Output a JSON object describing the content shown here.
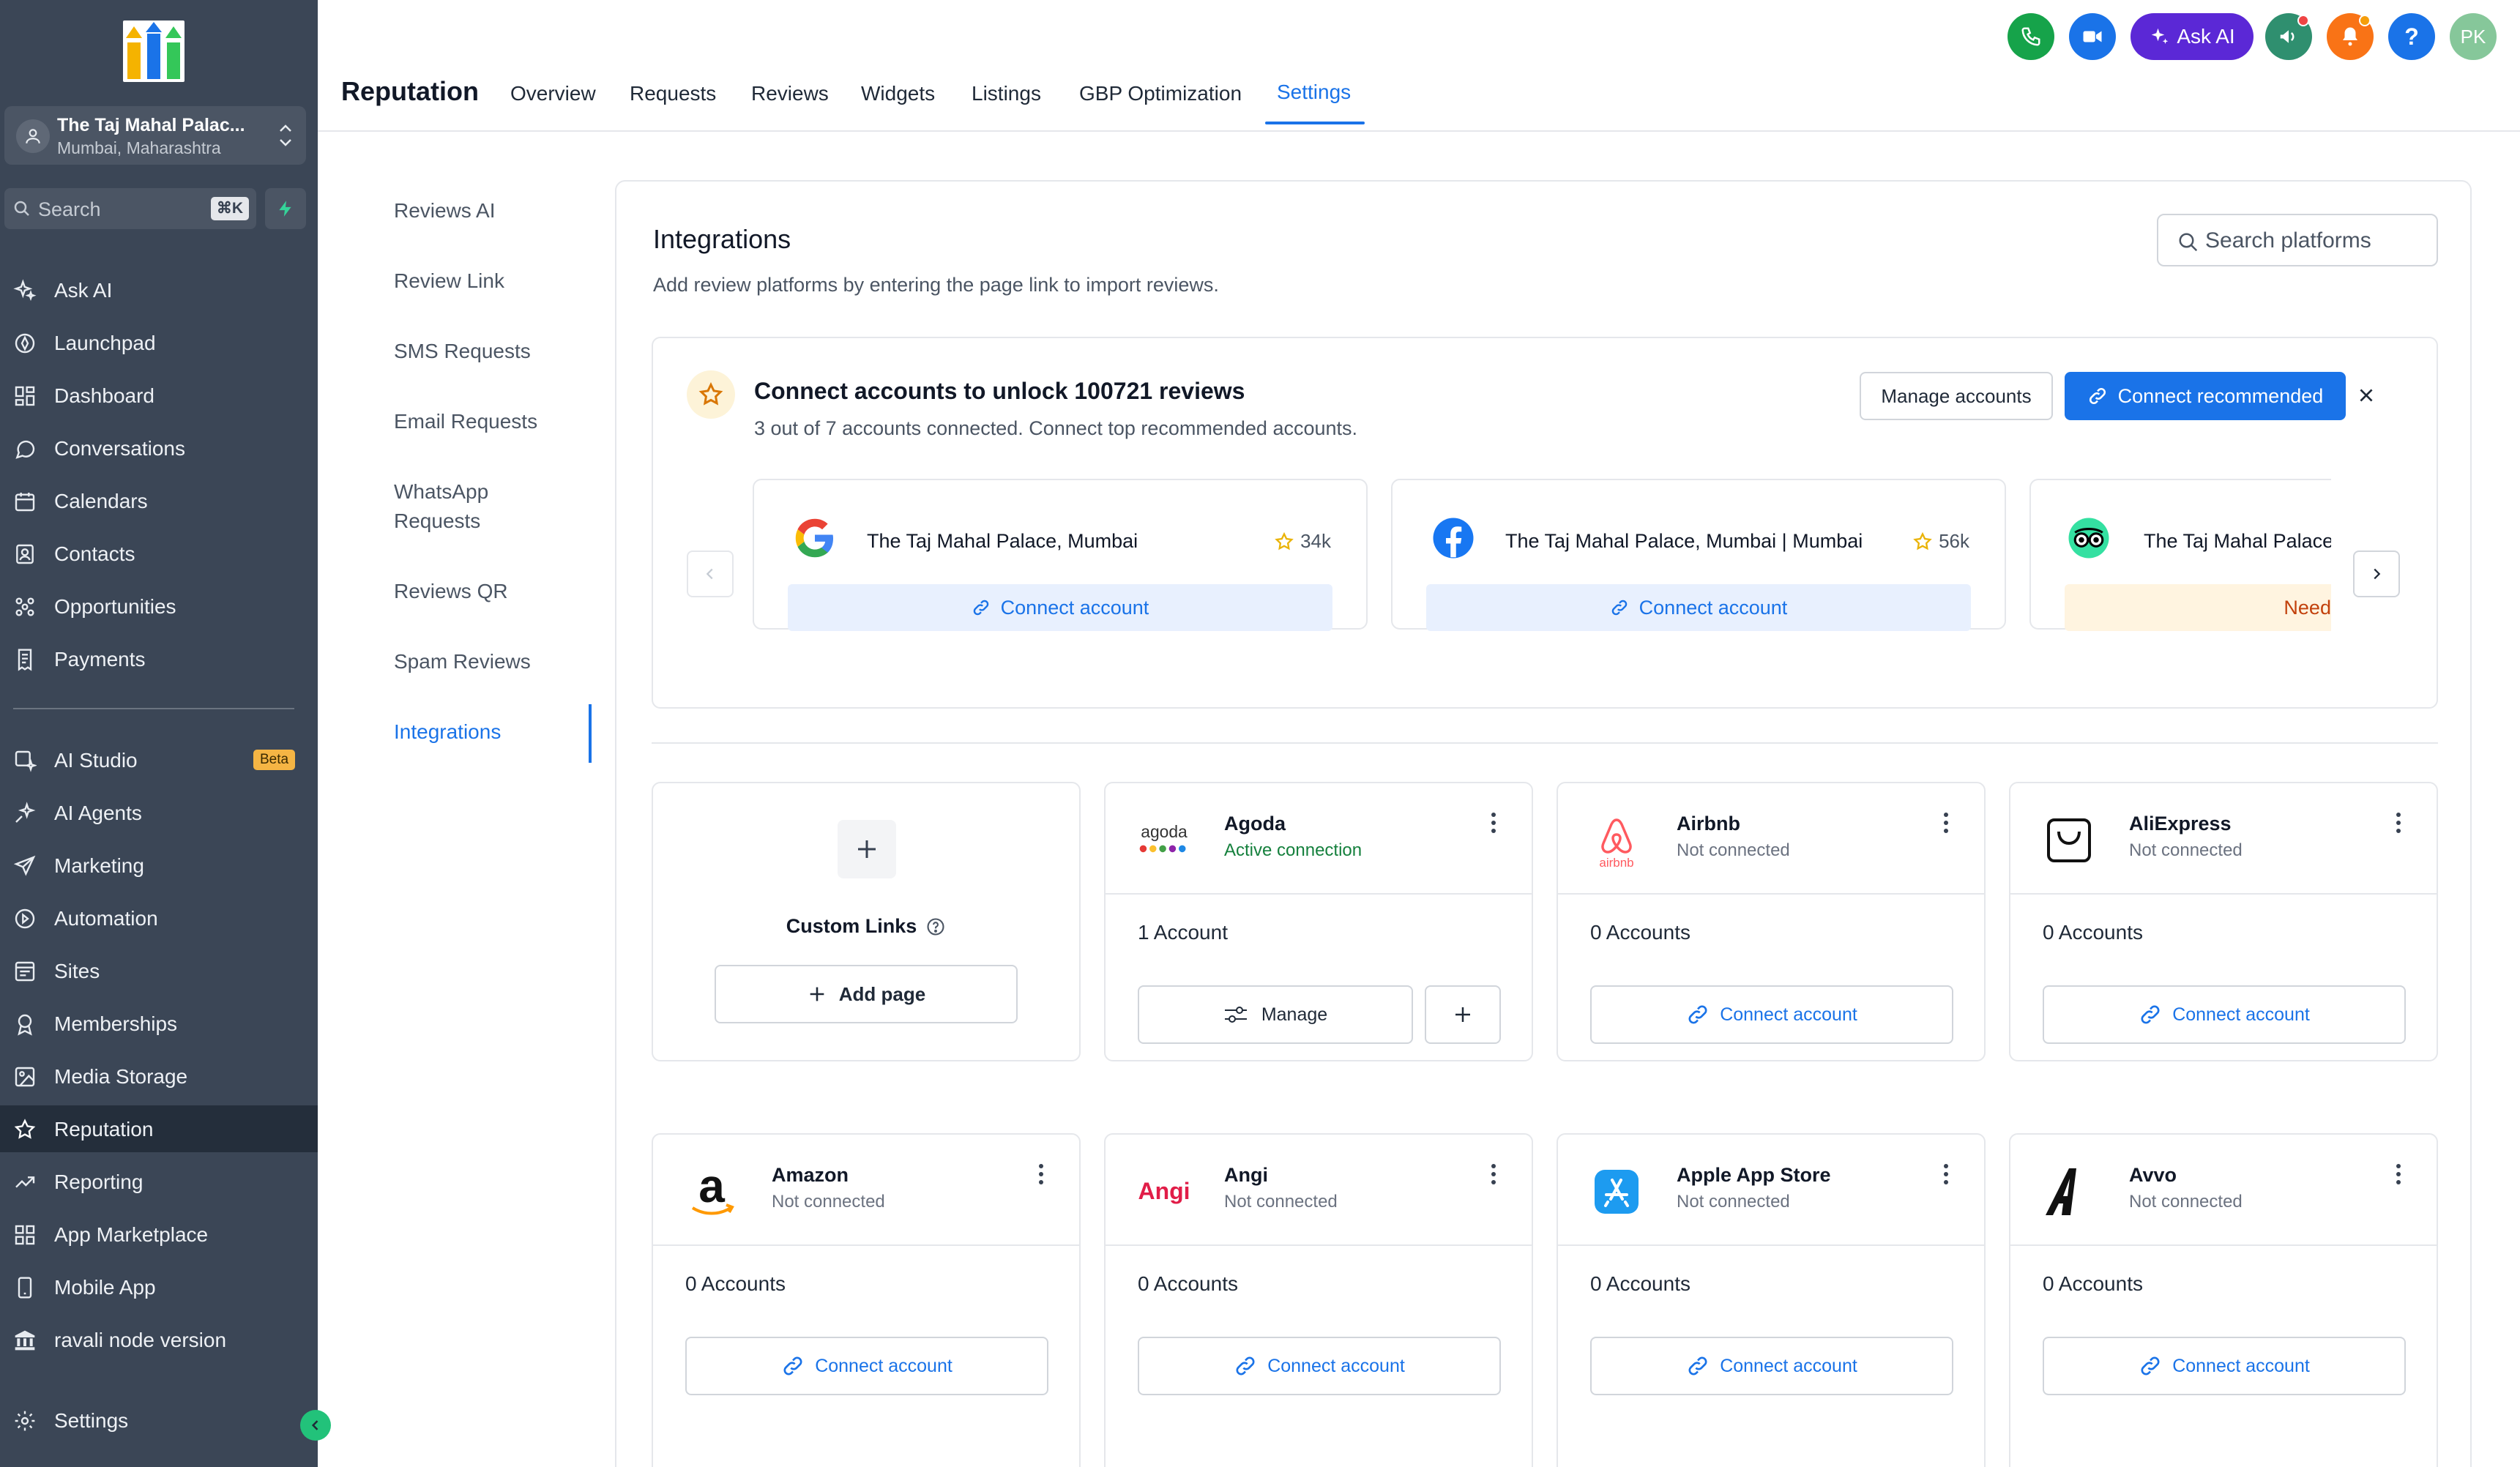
{
  "sidebar": {
    "location": {
      "name": "The Taj Mahal Palac...",
      "city": "Mumbai, Maharashtra"
    },
    "search": {
      "placeholder": "Search",
      "shortcut": "⌘K"
    },
    "items": [
      {
        "label": "Ask AI",
        "icon": "sparkles-icon"
      },
      {
        "label": "Launchpad",
        "icon": "rocket-icon"
      },
      {
        "label": "Dashboard",
        "icon": "grid-icon"
      },
      {
        "label": "Conversations",
        "icon": "chat-icon"
      },
      {
        "label": "Calendars",
        "icon": "calendar-icon"
      },
      {
        "label": "Contacts",
        "icon": "contacts-icon"
      },
      {
        "label": "Opportunities",
        "icon": "funnel-icon"
      },
      {
        "label": "Payments",
        "icon": "receipt-icon"
      }
    ],
    "items2": [
      {
        "label": "AI Studio",
        "icon": "ai-studio-icon",
        "badge": "Beta"
      },
      {
        "label": "AI Agents",
        "icon": "agents-icon"
      },
      {
        "label": "Marketing",
        "icon": "send-icon"
      },
      {
        "label": "Automation",
        "icon": "automation-icon"
      },
      {
        "label": "Sites",
        "icon": "sites-icon"
      },
      {
        "label": "Memberships",
        "icon": "membership-icon"
      },
      {
        "label": "Media Storage",
        "icon": "media-icon"
      },
      {
        "label": "Reputation",
        "icon": "star-icon"
      },
      {
        "label": "Reporting",
        "icon": "trend-icon"
      },
      {
        "label": "App Marketplace",
        "icon": "apps-icon"
      },
      {
        "label": "Mobile App",
        "icon": "mobile-icon"
      },
      {
        "label": "ravali node version",
        "icon": "bank-icon"
      }
    ],
    "settings": "Settings"
  },
  "header": {
    "title": "Reputation",
    "tabs": [
      "Overview",
      "Requests",
      "Reviews",
      "Widgets",
      "Listings",
      "GBP Optimization",
      "Settings"
    ],
    "active_tab": "Settings",
    "ask_ai": "Ask AI",
    "avatar": "PK",
    "help": "?"
  },
  "settings_menu": [
    "Reviews AI",
    "Review Link",
    "SMS Requests",
    "Email Requests",
    "WhatsApp Requests",
    "Reviews QR",
    "Spam Reviews",
    "Integrations"
  ],
  "integrations": {
    "title": "Integrations",
    "subtitle": "Add review platforms by entering the page link to import reviews.",
    "search_placeholder": "Search platforms",
    "banner": {
      "title": "Connect accounts to unlock 100721 reviews",
      "subtitle": "3 out of 7 accounts connected. Connect top recommended accounts.",
      "manage": "Manage accounts",
      "connect": "Connect recommended"
    },
    "recommended": [
      {
        "name": "The Taj Mahal Palace, Mumbai",
        "rating": "34k",
        "action": "Connect account"
      },
      {
        "name": "The Taj Mahal Palace, Mumbai | Mumbai",
        "rating": "56k",
        "action": "Connect account"
      },
      {
        "name": "The Taj Mahal Palace,",
        "action": "Needs a"
      }
    ],
    "custom": {
      "label": "Custom Links",
      "add": "Add page"
    },
    "platforms": [
      {
        "name": "Agoda",
        "status": "Active connection",
        "count": "1 Account",
        "action": "Manage"
      },
      {
        "name": "Airbnb",
        "status": "Not connected",
        "count": "0 Accounts",
        "action": "Connect account"
      },
      {
        "name": "AliExpress",
        "status": "Not connected",
        "count": "0 Accounts",
        "action": "Connect account"
      },
      {
        "name": "Amazon",
        "status": "Not connected",
        "count": "0 Accounts",
        "action": "Connect account"
      },
      {
        "name": "Angi",
        "status": "Not connected",
        "count": "0 Accounts",
        "action": "Connect account"
      },
      {
        "name": "Apple App Store",
        "status": "Not connected",
        "count": "0 Accounts",
        "action": "Connect account"
      },
      {
        "name": "Avvo",
        "status": "Not connected",
        "count": "0 Accounts",
        "action": "Connect account"
      }
    ],
    "logo_text": {
      "agoda": "agoda",
      "airbnb": "airbnb",
      "angi": "Angi"
    }
  },
  "colors": {
    "accent": "#1a73e8",
    "sidebar": "#3b4656",
    "active_green": "#15803d"
  }
}
